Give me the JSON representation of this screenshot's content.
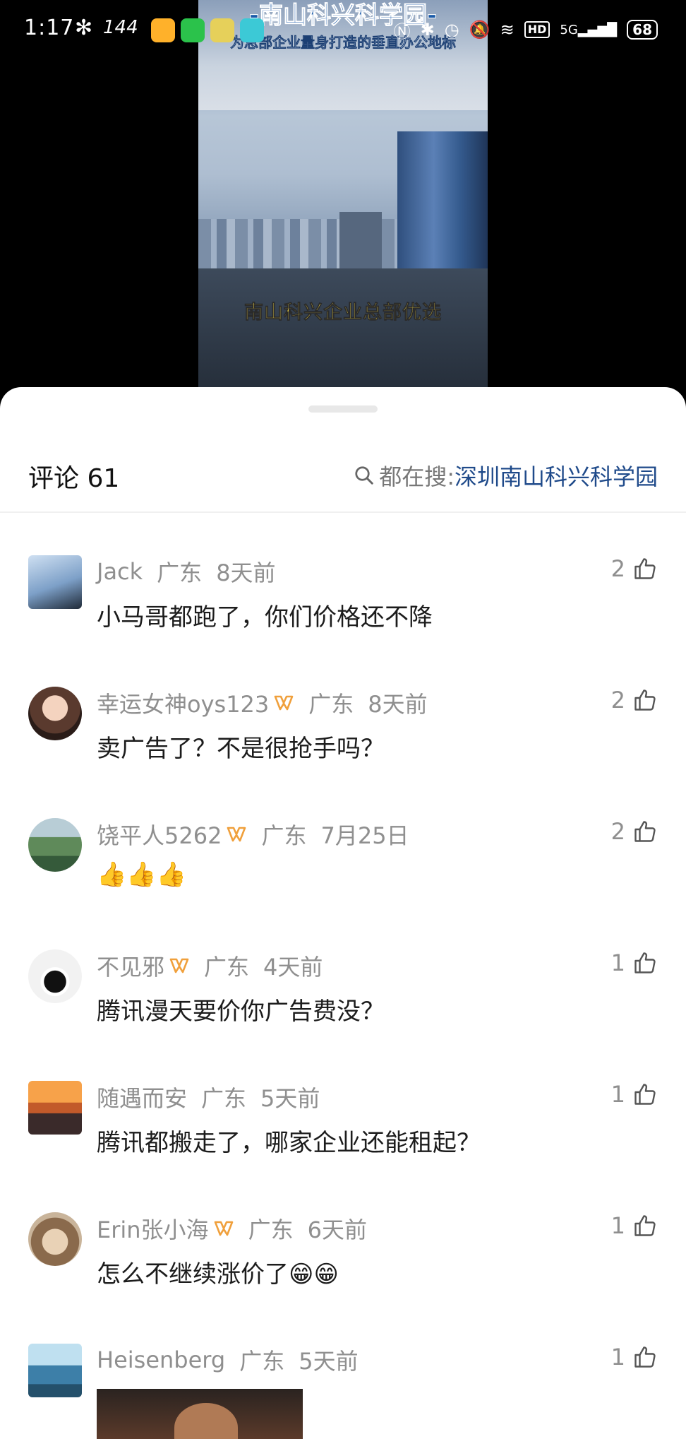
{
  "status_bar": {
    "time": "1:17",
    "refresh_rate": "144",
    "network": "5G",
    "hd": "HD",
    "battery": "68"
  },
  "video": {
    "title": "-南山科兴科学园-",
    "subtitle": "为总部企业量身打造的垂直办公地标",
    "caption": "南山科兴企业总部优选"
  },
  "comments_panel": {
    "title": "评论 61",
    "search_prefix": "都在搜:",
    "search_term": "深圳南山科兴科学园"
  },
  "comments": [
    {
      "user": "Jack",
      "region": "广东",
      "time": "8天前",
      "text": "小马哥都跑了，你们价格还不降",
      "likes": "2",
      "avatar": "motorcycle-avatar",
      "badge": false
    },
    {
      "user": "幸运女神oys123",
      "region": "广东",
      "time": "8天前",
      "text": "卖广告了？不是很抢手吗？",
      "likes": "2",
      "avatar": "girl-avatar",
      "badge": true
    },
    {
      "user": "饶平人5262",
      "region": "广东",
      "time": "7月25日",
      "text": "👍👍👍",
      "likes": "2",
      "avatar": "landscape-avatar",
      "badge": true
    },
    {
      "user": "不见邪",
      "region": "广东",
      "time": "4天前",
      "text": "腾讯漫天要价你广告费没？",
      "likes": "1",
      "avatar": "penguin-avatar",
      "badge": true
    },
    {
      "user": "随遇而安",
      "region": "广东",
      "time": "5天前",
      "text": "腾讯都搬走了，哪家企业还能租起？",
      "likes": "1",
      "avatar": "sunset-avatar",
      "badge": false
    },
    {
      "user": "Erin张小海",
      "region": "广东",
      "time": "6天前",
      "text": "怎么不继续涨价了😁😁",
      "likes": "1",
      "avatar": "cat-avatar",
      "badge": true
    },
    {
      "user": "Heisenberg",
      "region": "广东",
      "time": "5天前",
      "text": "",
      "likes": "1",
      "avatar": "seaside-avatar",
      "badge": false
    }
  ],
  "colors": {
    "accent_link": "#1f4a8a",
    "meta_gray": "#8f8f8f",
    "badge_orange": "#f0a03c",
    "caption_yellow": "#ffe24a"
  }
}
